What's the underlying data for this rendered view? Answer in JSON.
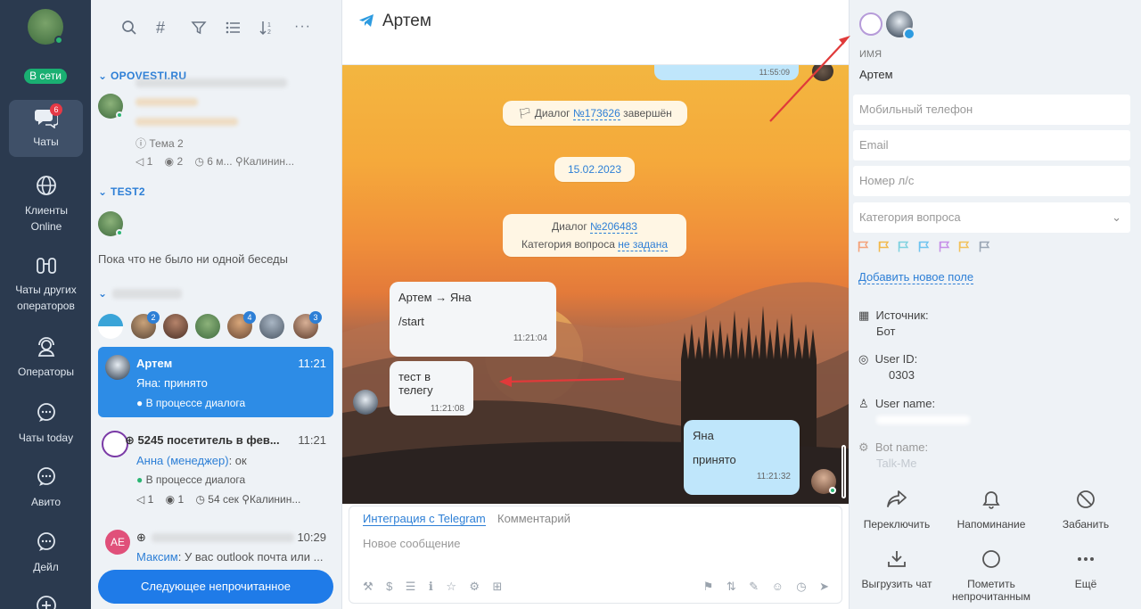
{
  "rail": {
    "status": "В сети",
    "items": [
      {
        "label": "Чаты",
        "badge": "6"
      },
      {
        "label": "Клиенты Online"
      },
      {
        "label": "Чаты других операторов"
      },
      {
        "label": "Операторы"
      },
      {
        "label": "Чаты today"
      },
      {
        "label": "Авито"
      },
      {
        "label": "Дейл"
      }
    ]
  },
  "list": {
    "groups": [
      {
        "name": "OPOVESTI.RU"
      },
      {
        "name": "TEST2"
      }
    ],
    "g1": {
      "topic": "Тема 2",
      "views": "1",
      "eye": "2",
      "time": "6 м...",
      "location": "Калинин..."
    },
    "g2": {
      "empty": "Пока что не было ни одной беседы"
    },
    "avatar_badges": [
      "2",
      "4",
      "3"
    ],
    "selected": {
      "name": "Артем",
      "time": "11:21",
      "last": "Яна: принято",
      "status": "В процессе диалога"
    },
    "item2": {
      "name": "5245 посетитель в фев...",
      "time": "11:21",
      "sender": "Анна (менеджер)",
      "text": ": ок",
      "status": "В процессе диалога",
      "views": "1",
      "eye": "1",
      "duration": "54 сек",
      "location": "Калинин..."
    },
    "item3": {
      "initials": "AE",
      "time": "10:29",
      "sender": "Максим",
      "text": ": У вас outlook почта или ..."
    },
    "next_button": "Следующее непрочитанное"
  },
  "chat": {
    "title": "Артем",
    "dialog1": {
      "prefix": "Диалог ",
      "num": "№173626",
      "suffix": " завершён"
    },
    "date": "15.02.2023",
    "dialog2": {
      "prefix": "Диалог ",
      "num": "№206483",
      "cat_prefix": "Категория вопроса ",
      "cat_value": "не задана"
    },
    "messages": [
      {
        "header": "Артем → Яна",
        "text": "/start",
        "time": "11:21:04"
      },
      {
        "text": "тест в телегу",
        "time": "11:21:08"
      },
      {
        "header": "Яна",
        "text": "принято",
        "time": "11:21:32"
      }
    ],
    "top_time": "11:55:09",
    "composer": {
      "tab_active": "Интеграция с Telegram",
      "tab_other": "Комментарий",
      "placeholder": "Новое сообщение"
    }
  },
  "right": {
    "name_label": "ИМЯ",
    "name_value": "Артем",
    "phone_placeholder": "Мобильный телефон",
    "email_placeholder": "Email",
    "account_placeholder": "Номер л/с",
    "category_placeholder": "Категория вопроса",
    "flag_colors": [
      "#f4a27a",
      "#f2b84b",
      "#7fd1e0",
      "#6ec3f0",
      "#c68ee8",
      "#f2c15a",
      "#9aa6b5"
    ],
    "add_field": "Добавить новое поле",
    "source_label": "Источник:",
    "source_value": "Бот",
    "userid_label": "User ID:",
    "userid_value": "0303",
    "username_label": "User name:",
    "botname_label": "Bot name:",
    "botname_value": "Talk-Me",
    "actions": [
      "Переключить",
      "Напоминание",
      "Забанить",
      "Выгрузить чат",
      "Пометить непрочитанным",
      "Ещё"
    ]
  }
}
